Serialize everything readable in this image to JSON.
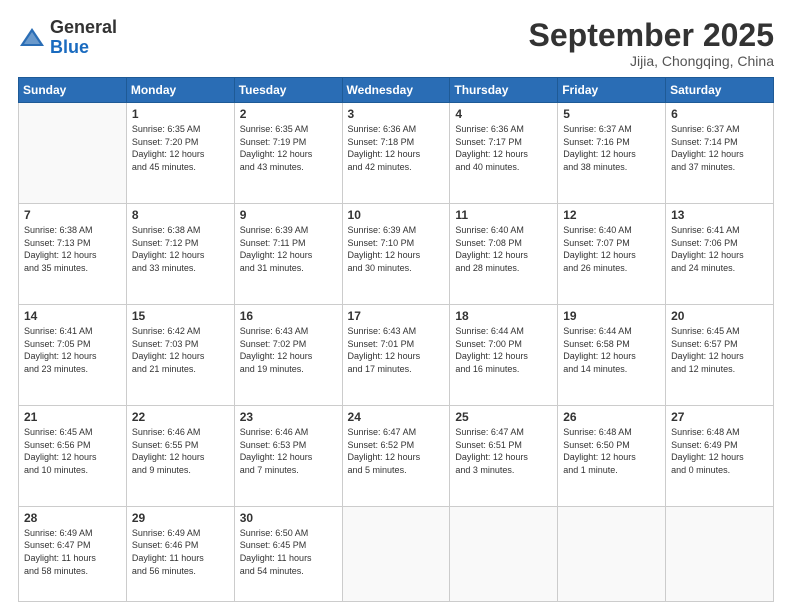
{
  "logo": {
    "general": "General",
    "blue": "Blue"
  },
  "header": {
    "month": "September 2025",
    "location": "Jijia, Chongqing, China"
  },
  "weekdays": [
    "Sunday",
    "Monday",
    "Tuesday",
    "Wednesday",
    "Thursday",
    "Friday",
    "Saturday"
  ],
  "weeks": [
    [
      {
        "day": "",
        "info": ""
      },
      {
        "day": "1",
        "info": "Sunrise: 6:35 AM\nSunset: 7:20 PM\nDaylight: 12 hours\nand 45 minutes."
      },
      {
        "day": "2",
        "info": "Sunrise: 6:35 AM\nSunset: 7:19 PM\nDaylight: 12 hours\nand 43 minutes."
      },
      {
        "day": "3",
        "info": "Sunrise: 6:36 AM\nSunset: 7:18 PM\nDaylight: 12 hours\nand 42 minutes."
      },
      {
        "day": "4",
        "info": "Sunrise: 6:36 AM\nSunset: 7:17 PM\nDaylight: 12 hours\nand 40 minutes."
      },
      {
        "day": "5",
        "info": "Sunrise: 6:37 AM\nSunset: 7:16 PM\nDaylight: 12 hours\nand 38 minutes."
      },
      {
        "day": "6",
        "info": "Sunrise: 6:37 AM\nSunset: 7:14 PM\nDaylight: 12 hours\nand 37 minutes."
      }
    ],
    [
      {
        "day": "7",
        "info": "Sunrise: 6:38 AM\nSunset: 7:13 PM\nDaylight: 12 hours\nand 35 minutes."
      },
      {
        "day": "8",
        "info": "Sunrise: 6:38 AM\nSunset: 7:12 PM\nDaylight: 12 hours\nand 33 minutes."
      },
      {
        "day": "9",
        "info": "Sunrise: 6:39 AM\nSunset: 7:11 PM\nDaylight: 12 hours\nand 31 minutes."
      },
      {
        "day": "10",
        "info": "Sunrise: 6:39 AM\nSunset: 7:10 PM\nDaylight: 12 hours\nand 30 minutes."
      },
      {
        "day": "11",
        "info": "Sunrise: 6:40 AM\nSunset: 7:08 PM\nDaylight: 12 hours\nand 28 minutes."
      },
      {
        "day": "12",
        "info": "Sunrise: 6:40 AM\nSunset: 7:07 PM\nDaylight: 12 hours\nand 26 minutes."
      },
      {
        "day": "13",
        "info": "Sunrise: 6:41 AM\nSunset: 7:06 PM\nDaylight: 12 hours\nand 24 minutes."
      }
    ],
    [
      {
        "day": "14",
        "info": "Sunrise: 6:41 AM\nSunset: 7:05 PM\nDaylight: 12 hours\nand 23 minutes."
      },
      {
        "day": "15",
        "info": "Sunrise: 6:42 AM\nSunset: 7:03 PM\nDaylight: 12 hours\nand 21 minutes."
      },
      {
        "day": "16",
        "info": "Sunrise: 6:43 AM\nSunset: 7:02 PM\nDaylight: 12 hours\nand 19 minutes."
      },
      {
        "day": "17",
        "info": "Sunrise: 6:43 AM\nSunset: 7:01 PM\nDaylight: 12 hours\nand 17 minutes."
      },
      {
        "day": "18",
        "info": "Sunrise: 6:44 AM\nSunset: 7:00 PM\nDaylight: 12 hours\nand 16 minutes."
      },
      {
        "day": "19",
        "info": "Sunrise: 6:44 AM\nSunset: 6:58 PM\nDaylight: 12 hours\nand 14 minutes."
      },
      {
        "day": "20",
        "info": "Sunrise: 6:45 AM\nSunset: 6:57 PM\nDaylight: 12 hours\nand 12 minutes."
      }
    ],
    [
      {
        "day": "21",
        "info": "Sunrise: 6:45 AM\nSunset: 6:56 PM\nDaylight: 12 hours\nand 10 minutes."
      },
      {
        "day": "22",
        "info": "Sunrise: 6:46 AM\nSunset: 6:55 PM\nDaylight: 12 hours\nand 9 minutes."
      },
      {
        "day": "23",
        "info": "Sunrise: 6:46 AM\nSunset: 6:53 PM\nDaylight: 12 hours\nand 7 minutes."
      },
      {
        "day": "24",
        "info": "Sunrise: 6:47 AM\nSunset: 6:52 PM\nDaylight: 12 hours\nand 5 minutes."
      },
      {
        "day": "25",
        "info": "Sunrise: 6:47 AM\nSunset: 6:51 PM\nDaylight: 12 hours\nand 3 minutes."
      },
      {
        "day": "26",
        "info": "Sunrise: 6:48 AM\nSunset: 6:50 PM\nDaylight: 12 hours\nand 1 minute."
      },
      {
        "day": "27",
        "info": "Sunrise: 6:48 AM\nSunset: 6:49 PM\nDaylight: 12 hours\nand 0 minutes."
      }
    ],
    [
      {
        "day": "28",
        "info": "Sunrise: 6:49 AM\nSunset: 6:47 PM\nDaylight: 11 hours\nand 58 minutes."
      },
      {
        "day": "29",
        "info": "Sunrise: 6:49 AM\nSunset: 6:46 PM\nDaylight: 11 hours\nand 56 minutes."
      },
      {
        "day": "30",
        "info": "Sunrise: 6:50 AM\nSunset: 6:45 PM\nDaylight: 11 hours\nand 54 minutes."
      },
      {
        "day": "",
        "info": ""
      },
      {
        "day": "",
        "info": ""
      },
      {
        "day": "",
        "info": ""
      },
      {
        "day": "",
        "info": ""
      }
    ]
  ]
}
